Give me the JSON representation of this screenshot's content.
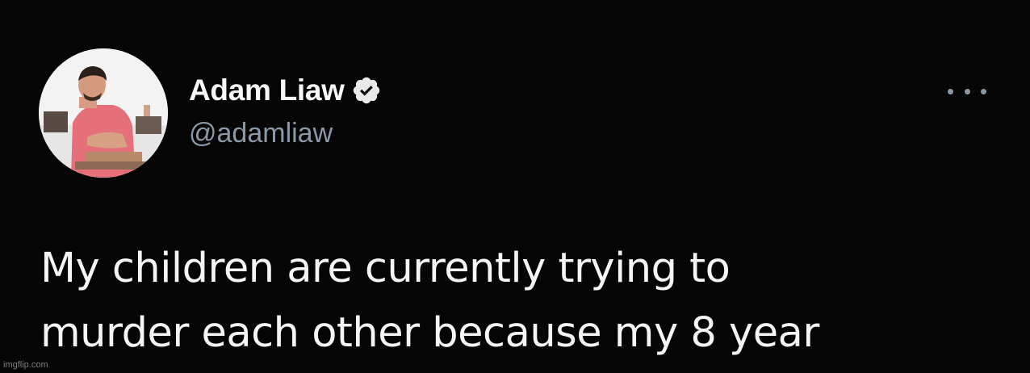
{
  "author": {
    "display_name": "Adam Liaw",
    "handle": "@adamliaw",
    "verified": true,
    "avatar_icon": "profile-photo"
  },
  "menu": {
    "icon": "more-options-icon"
  },
  "tweet": {
    "text": "My children are currently trying to\nmurder each other because my 8 year"
  },
  "watermark": {
    "text": "imgflip.com"
  },
  "colors": {
    "background": "#050505",
    "name": "#f5f7f9",
    "handle": "#8b98a5",
    "verified_badge": "#e7e9ea",
    "text": "#f3f5f7"
  }
}
